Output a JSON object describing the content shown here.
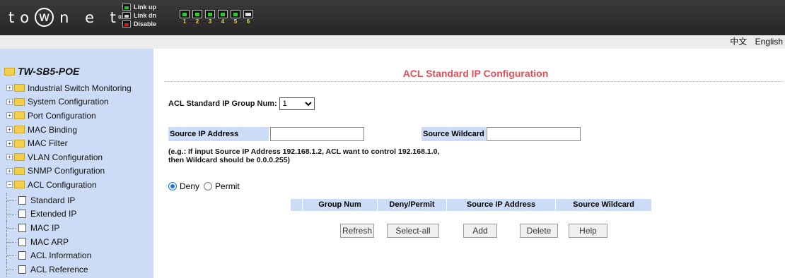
{
  "header": {
    "brand": {
      "t": "t",
      "o": "o",
      "w": "w",
      "rest": "n e t",
      "reg": "®"
    },
    "legend": [
      {
        "label": "Link up",
        "state": "up"
      },
      {
        "label": "Link dn",
        "state": "dn"
      },
      {
        "label": "Disable",
        "state": "dis"
      }
    ],
    "ports": [
      "1",
      "2",
      "3",
      "4",
      "5",
      "6"
    ]
  },
  "langbar": {
    "zh": "中文",
    "en": "English"
  },
  "sidebar": {
    "device": "TW-SB5-POE",
    "items": [
      "Industrial Switch Monitoring",
      "System Configuration",
      "Port Configuration",
      "MAC Binding",
      "MAC Filter",
      "VLAN Configuration",
      "SNMP Configuration",
      "ACL Configuration"
    ],
    "acl_sub": [
      "Standard IP",
      "Extended IP",
      "MAC IP",
      "MAC ARP",
      "ACL Information",
      "ACL Reference"
    ]
  },
  "main": {
    "title": "ACL Standard IP Configuration",
    "group_label": "ACL Standard IP Group Num:",
    "group_value": "1",
    "source_ip_label": "Source IP Address",
    "source_ip_value": "",
    "source_wildcard_label": "Source Wildcard",
    "source_wildcard_value": "",
    "note_line1": "(e.g.: If input Source IP Address 192.168.1.2, ACL want to control 192.168.1.0,",
    "note_line2": "then Wildcard should be 0.0.0.255)",
    "deny_label": "Deny",
    "permit_label": "Permit",
    "selected_action": "Deny",
    "table_headers": [
      "",
      "Group Num",
      "Deny/Permit",
      "Source IP Address",
      "Source Wildcard"
    ],
    "buttons": {
      "refresh": "Refresh",
      "select_all": "Select-all",
      "add": "Add",
      "delete": "Delete",
      "help": "Help"
    }
  },
  "colors": {
    "header_bg": "#2e2e2e",
    "sidebar_bg": "#ccdcf6",
    "title_color": "#e0525a",
    "radio_accent": "#1a73e8"
  }
}
